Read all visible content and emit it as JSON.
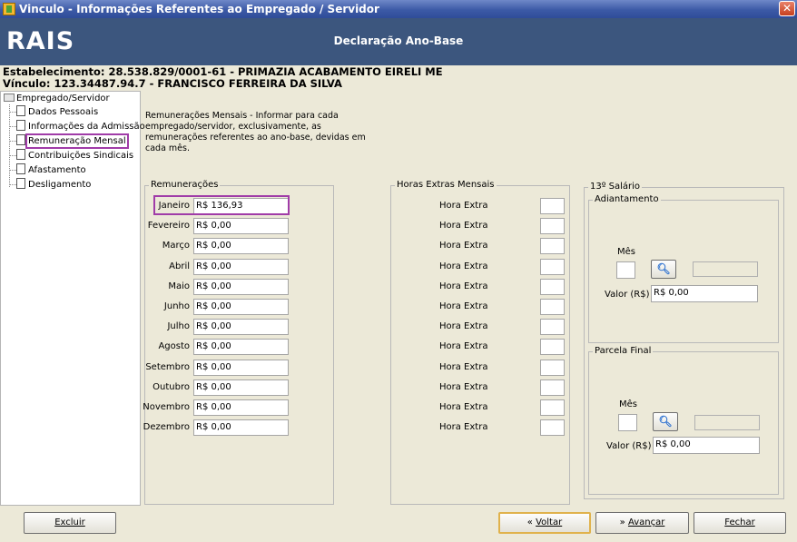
{
  "window": {
    "title": "Vinculo - Informações Referentes ao Empregado / Servidor",
    "close_glyph": "✕"
  },
  "header": {
    "logo": "RAIS",
    "title": "Declaração Ano-Base"
  },
  "info": {
    "estabelecimento": "Estabelecimento: 28.538.829/0001-61 - PRIMAZIA ACABAMENTO EIRELI ME",
    "vinculo": "Vínculo: 123.34487.94.7 - FRANCISCO FERREIRA DA SILVA"
  },
  "tree": {
    "root": "Empregado/Servidor",
    "items": [
      {
        "label": "Dados Pessoais"
      },
      {
        "label": "Informações da Admissão"
      },
      {
        "label": "Remuneração Mensal"
      },
      {
        "label": "Contribuições Sindicais"
      },
      {
        "label": "Afastamento"
      },
      {
        "label": "Desligamento"
      }
    ]
  },
  "description": "Remunerações Mensais - Informar para cada empregado/servidor, exclusivamente, as remunerações referentes ao ano-base, devidas em cada mês.",
  "remuneracoes": {
    "title": "Remunerações",
    "months": [
      {
        "label": "Janeiro",
        "value": "R$ 136,93"
      },
      {
        "label": "Fevereiro",
        "value": "R$ 0,00"
      },
      {
        "label": "Março",
        "value": "R$ 0,00"
      },
      {
        "label": "Abril",
        "value": "R$ 0,00"
      },
      {
        "label": "Maio",
        "value": "R$ 0,00"
      },
      {
        "label": "Junho",
        "value": "R$ 0,00"
      },
      {
        "label": "Julho",
        "value": "R$ 0,00"
      },
      {
        "label": "Agosto",
        "value": "R$ 0,00"
      },
      {
        "label": "Setembro",
        "value": "R$ 0,00"
      },
      {
        "label": "Outubro",
        "value": "R$ 0,00"
      },
      {
        "label": "Novembro",
        "value": "R$ 0,00"
      },
      {
        "label": "Dezembro",
        "value": "R$ 0,00"
      }
    ]
  },
  "horas_extras": {
    "title": "Horas Extras Mensais",
    "row_label": "Hora Extra",
    "values": [
      "",
      "",
      "",
      "",
      "",
      "",
      "",
      "",
      "",
      "",
      "",
      ""
    ]
  },
  "decimo_terceiro": {
    "title": "13º Salário",
    "adiantamento": {
      "title": "Adiantamento",
      "mes_label": "Mês",
      "mes_value": "",
      "valor_label": "Valor (R$)",
      "valor_value": "R$ 0,00",
      "search_icon": "magnifier-icon"
    },
    "parcela_final": {
      "title": "Parcela Final",
      "mes_label": "Mês",
      "mes_value": "",
      "valor_label": "Valor (R$)",
      "valor_value": "R$ 0,00",
      "search_icon": "magnifier-icon"
    }
  },
  "buttons": {
    "excluir": "Excluir",
    "voltar": "Voltar",
    "avancar": "Avançar",
    "fechar": "Fechar"
  },
  "colors": {
    "header_bg": "#3c567e",
    "highlight": "#a03ca8",
    "titlebar": "#3c5aa6"
  }
}
